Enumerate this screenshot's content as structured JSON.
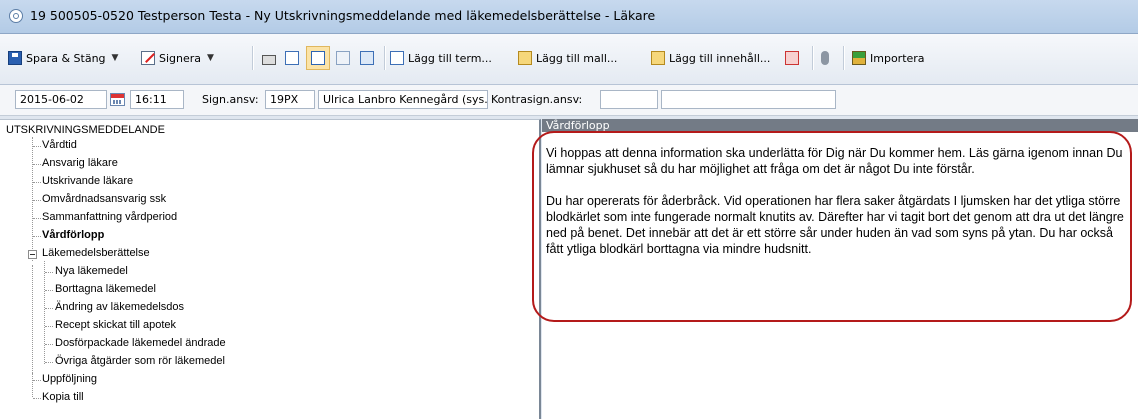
{
  "window": {
    "title": "19 500505-0520 Testperson Testa - Ny Utskrivningsmeddelande med läkemedelsberättelse - Läkare"
  },
  "toolbar": {
    "save_close_label": "Spara & Stäng",
    "sign_label": "Signera",
    "add_term_label": "Lägg till term...",
    "add_template_label": "Lägg till mall...",
    "add_content_label": "Lägg till innehåll...",
    "import_label": "Importera"
  },
  "fields": {
    "date": "2015-06-02",
    "time": "16:11",
    "sign_resp_label": "Sign.ansv:",
    "sign_resp_code": "19PX",
    "sign_resp_name": "Ulrica Lanbro Kennegård (sys.",
    "cosign_label": "Kontrasign.ansv:",
    "cosign_value": "",
    "extra_value": ""
  },
  "tree": {
    "root": "UTSKRIVNINGSMEDDELANDE",
    "items": [
      "Vårdtid",
      "Ansvarig läkare",
      "Utskrivande läkare",
      "Omvårdnadsansvarig ssk",
      "Sammanfattning vårdperiod",
      "Vårdförlopp",
      "Läkemedelsberättelse",
      "Nya läkemedel",
      "Borttagna läkemedel",
      "Ändring av läkemedelsdos",
      "Recept skickat till apotek",
      "Dosförpackade läkemedel ändrade",
      "Övriga åtgärder som rör läkemedel",
      "Uppföljning",
      "Kopia till"
    ]
  },
  "panel": {
    "header": "Vårdförlopp",
    "paragraph1": "Vi hoppas att denna information ska underlätta för Dig när Du kommer hem. Läs gärna igenom innan Du lämnar sjukhuset så du har möjlighet att fråga om det är något Du inte förstår.",
    "paragraph2": "Du har opererats för åderbråck. Vid operationen har flera saker åtgärdats I ljumsken har det ytliga större blodkärlet som inte fungerade normalt knutits av. Därefter har vi tagit bort det genom att dra ut det längre ned på benet. Det innebär att det är ett större sår under huden än vad som syns på ytan. Du har också fått ytliga blodkärl borttagna via mindre hudsnitt."
  },
  "colors": {
    "highlight": "#b41a1a",
    "panel_header": "#737b86",
    "titlebar": "#b3cbe6"
  },
  "icons": [
    "app-icon",
    "save-icon",
    "sign-icon",
    "print-icon",
    "preview-icon",
    "layout-icon",
    "layout2-icon",
    "document-icon",
    "add-term-icon",
    "add-template-icon",
    "add-content-icon",
    "delete-icon",
    "microphone-icon",
    "import-icon",
    "calendar-icon"
  ]
}
